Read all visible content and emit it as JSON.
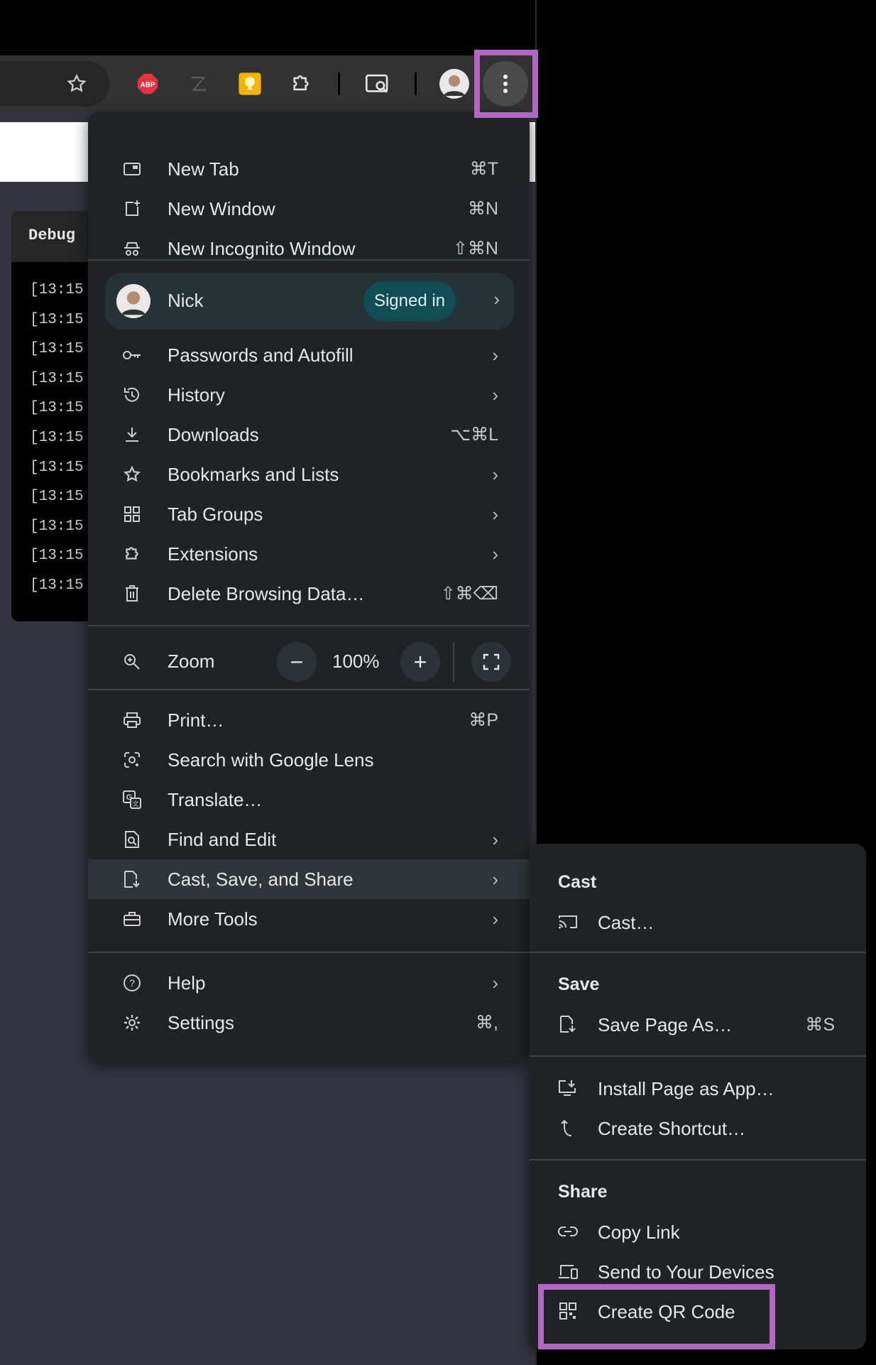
{
  "debug": {
    "title": "Debug",
    "lines": [
      "[13:15",
      "[13:15",
      "[13:15",
      "[13:15",
      "[13:15",
      "[13:15",
      "[13:15",
      "[13:15",
      "[13:15",
      "[13:15",
      "[13:15"
    ]
  },
  "toolbar": {
    "icons": [
      "star-icon",
      "abp-extension-icon",
      "z-extension-icon",
      "idea-extension-icon",
      "puzzle-extensions-icon",
      "tab-search-icon",
      "profile-avatar",
      "kebab-menu-icon"
    ],
    "abp_text": "ABP"
  },
  "menu": {
    "new_tab": {
      "label": "New Tab",
      "shortcut": "⌘T"
    },
    "new_window": {
      "label": "New Window",
      "shortcut": "⌘N"
    },
    "new_incognito": {
      "label": "New Incognito Window",
      "shortcut": "⇧⌘N"
    },
    "profile": {
      "name": "Nick",
      "status": "Signed in"
    },
    "passwords": {
      "label": "Passwords and Autofill"
    },
    "history": {
      "label": "History"
    },
    "downloads": {
      "label": "Downloads",
      "shortcut": "⌥⌘L"
    },
    "bookmarks": {
      "label": "Bookmarks and Lists"
    },
    "tab_groups": {
      "label": "Tab Groups"
    },
    "extensions": {
      "label": "Extensions"
    },
    "delete_data": {
      "label": "Delete Browsing Data…",
      "shortcut": "⇧⌘⌫"
    },
    "zoom": {
      "label": "Zoom",
      "value": "100%",
      "minus": "−",
      "plus": "+"
    },
    "print": {
      "label": "Print…",
      "shortcut": "⌘P"
    },
    "lens": {
      "label": "Search with Google Lens"
    },
    "translate": {
      "label": "Translate…"
    },
    "find_edit": {
      "label": "Find and Edit"
    },
    "cast_save_share": {
      "label": "Cast, Save, and Share"
    },
    "more_tools": {
      "label": "More Tools"
    },
    "help": {
      "label": "Help"
    },
    "settings": {
      "label": "Settings",
      "shortcut": "⌘,"
    },
    "chevron": "›"
  },
  "submenu": {
    "cast_header": "Cast",
    "cast": "Cast…",
    "save_header": "Save",
    "save_page": {
      "label": "Save Page As…",
      "shortcut": "⌘S"
    },
    "install_app": "Install Page as App…",
    "create_shortcut": "Create Shortcut…",
    "share_header": "Share",
    "copy_link": "Copy Link",
    "send_devices": "Send to Your Devices",
    "create_qr": "Create QR Code"
  },
  "colors": {
    "menu_bg": "#1f2326",
    "highlight": "#b267c2",
    "signed_badge": "#114c55"
  }
}
